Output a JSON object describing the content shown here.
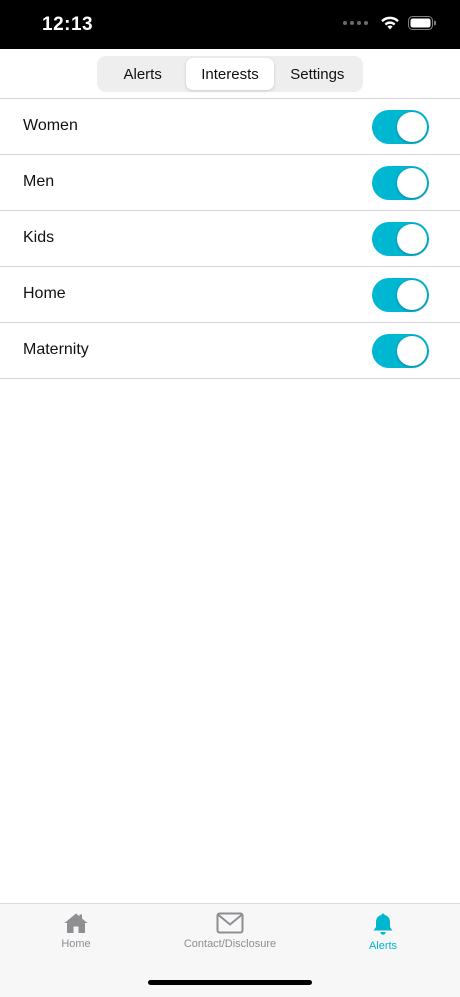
{
  "status_bar": {
    "time": "12:13"
  },
  "segmented_control": {
    "segments": [
      {
        "label": "Alerts",
        "active": false
      },
      {
        "label": "Interests",
        "active": true
      },
      {
        "label": "Settings",
        "active": false
      }
    ]
  },
  "interests": [
    {
      "label": "Women",
      "enabled": true
    },
    {
      "label": "Men",
      "enabled": true
    },
    {
      "label": "Kids",
      "enabled": true
    },
    {
      "label": "Home",
      "enabled": true
    },
    {
      "label": "Maternity",
      "enabled": true
    }
  ],
  "tab_bar": {
    "tabs": [
      {
        "label": "Home",
        "icon": "house-icon",
        "active": false
      },
      {
        "label": "Contact/Disclosure",
        "icon": "envelope-icon",
        "active": false
      },
      {
        "label": "Alerts",
        "icon": "bell-icon",
        "active": true
      }
    ]
  },
  "colors": {
    "accent": "#00b7d2",
    "inactive_tab": "#8e8e93",
    "status_bar_bg": "#000000"
  }
}
